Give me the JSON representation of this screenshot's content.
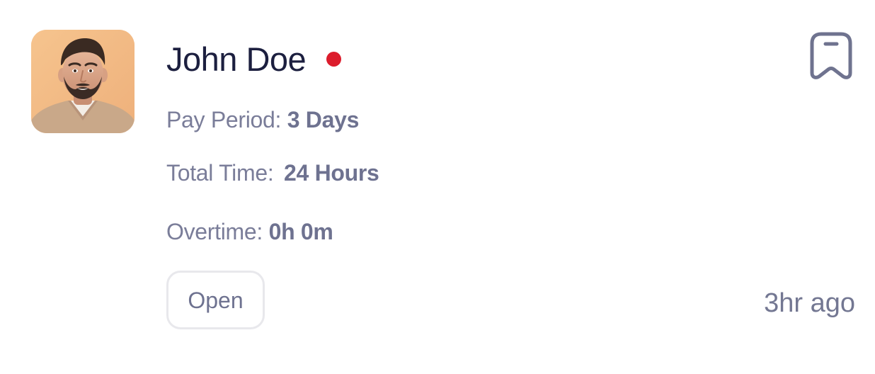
{
  "card": {
    "name": "John Doe",
    "status_color": "#dc1c2c",
    "status": "online-indicator",
    "avatar_icon": "person-photo",
    "bookmark_icon": "bookmark-icon",
    "pay_period_label": "Pay Period:",
    "pay_period_value": "3 Days",
    "total_time_label": "Total Time:",
    "total_time_value": "24 Hours",
    "overtime_label": "Overtime:",
    "overtime_value": "0h 0m",
    "action_label": "Open",
    "time_ago": "3hr ago"
  },
  "colors": {
    "title": "#1c1f3f",
    "text": "#7a7d99",
    "accent_red": "#dc1c2c",
    "avatar_bg": "#f2b986"
  }
}
